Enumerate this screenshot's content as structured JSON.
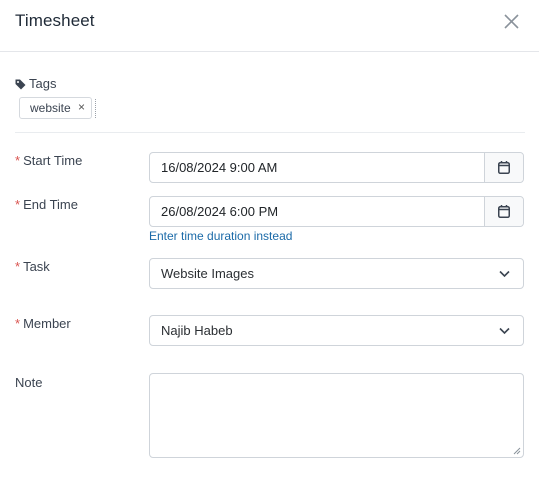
{
  "header": {
    "title": "Timesheet"
  },
  "icons": {
    "close": "close-icon",
    "tag": "tag-icon",
    "calendar": "calendar-icon",
    "chevron": "chevron-down-icon"
  },
  "tags": {
    "label": "Tags",
    "items": [
      {
        "text": "website",
        "remove": "×"
      }
    ]
  },
  "required_marker": "*",
  "form": {
    "start_time": {
      "label": "Start Time",
      "value": "16/08/2024 9:00 AM"
    },
    "end_time": {
      "label": "End Time",
      "value": "26/08/2024 6:00 PM"
    },
    "duration_link": "Enter time duration instead",
    "task": {
      "label": "Task",
      "value": "Website Images"
    },
    "member": {
      "label": "Member",
      "value": "Najib Habeb"
    },
    "note": {
      "label": "Note",
      "value": ""
    }
  },
  "colors": {
    "required": "#d9534f",
    "link": "#1b6aa8",
    "border": "#cfd4da"
  }
}
